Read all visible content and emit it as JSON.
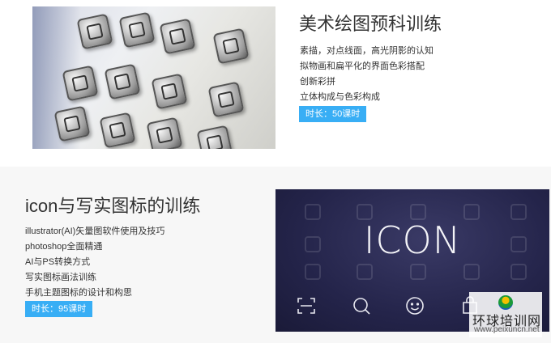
{
  "course1": {
    "title": "美术绘图预科训练",
    "lines": [
      "素描，对点线面，高光阴影的认知",
      "拟物画和扁平化的界面色彩搭配",
      "创新彩拼",
      "立体构成与色彩构成"
    ],
    "duration": "时长：50课时"
  },
  "course2": {
    "title": "icon与写实图标的训练",
    "lines": [
      "illustrator(AI)矢量图软件使用及技巧",
      "photoshop全面精通",
      "AI与PS转换方式",
      "写实图标画法训练",
      "手机主题图标的设计和构思"
    ],
    "duration": "时长：95课时",
    "image_text": "ICON"
  },
  "watermark": {
    "name": "环球培训网",
    "url": "www.peixuncn.net"
  },
  "colors": {
    "badge": "#38aef5",
    "title_text": "#333333",
    "section2_bg": "#f7f7f7"
  },
  "icons": [
    "sketched-app-icon",
    "scan-icon",
    "search-icon",
    "smile-icon",
    "bag-icon"
  ]
}
